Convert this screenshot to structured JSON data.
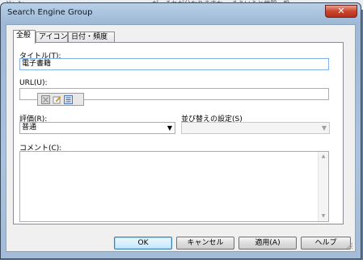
{
  "background": {
    "text_left": "ジャン",
    "text_right": "が、それが分かりますか。 そういうと世間一般"
  },
  "window": {
    "title": "Search Engine Group",
    "close_label": "✕"
  },
  "tabs": [
    {
      "label": "全般",
      "active": true
    },
    {
      "label": "アイコン",
      "active": false
    },
    {
      "label": "日付・頻度",
      "active": false
    }
  ],
  "form": {
    "title_label": "タイトル(T):",
    "title_value": "電子書籍",
    "url_label": "URL(U):",
    "url_value": "",
    "rating_label": "評価(R):",
    "rating_value": "普通",
    "sort_label": "並び替えの設定(S)",
    "sort_value": "",
    "comment_label": "コメント(C):",
    "comment_value": ""
  },
  "icons": {
    "popup": [
      "delete-icon",
      "edit-icon",
      "list-icon"
    ],
    "combo_arrow": "▼",
    "scroll_up": "▲",
    "scroll_down": "▼"
  },
  "buttons": {
    "ok": "OK",
    "cancel": "キャンセル",
    "apply": "適用(A)",
    "help": "ヘルプ"
  },
  "colors": {
    "title_bar": "#a9c3df",
    "close_button": "#c9452e",
    "default_button_border": "#3c7fb1"
  }
}
